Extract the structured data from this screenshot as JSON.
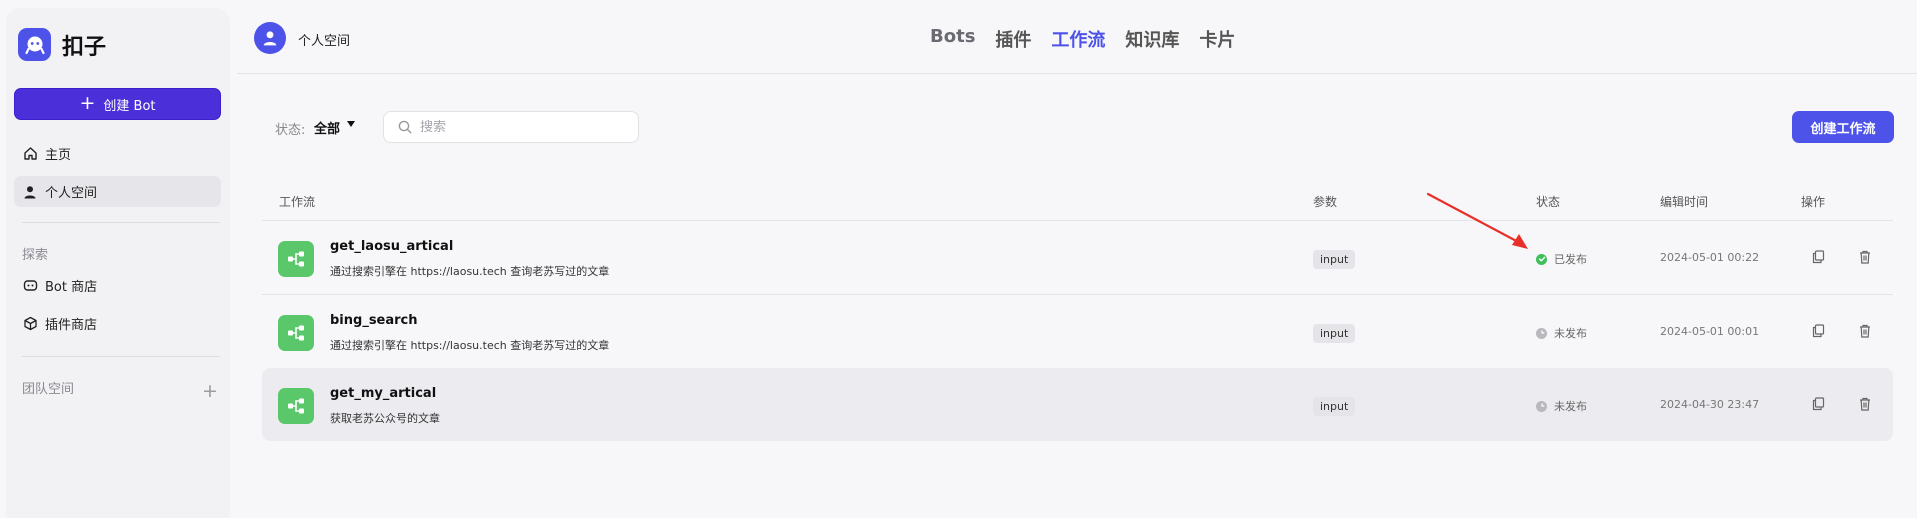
{
  "app": {
    "name": "扣子",
    "brand_color": "#4d53e8"
  },
  "sidebar": {
    "create_bot_label": "创建 Bot",
    "home_label": "主页",
    "personal_space_label": "个人空间",
    "explore_title": "探索",
    "bot_store_label": "Bot 商店",
    "plugin_store_label": "插件商店",
    "team_space_label": "团队空间"
  },
  "header": {
    "space_name": "个人空间",
    "tabs": [
      {
        "label": "Bots"
      },
      {
        "label": "插件"
      },
      {
        "label": "工作流",
        "active": true
      },
      {
        "label": "知识库"
      },
      {
        "label": "卡片"
      }
    ]
  },
  "toolbar": {
    "status_label": "状态:",
    "status_value": "全部",
    "search_placeholder": "搜索",
    "create_workflow_label": "创建工作流"
  },
  "table": {
    "columns": [
      "工作流",
      "参数",
      "状态",
      "编辑时间",
      "操作"
    ],
    "rows": [
      {
        "name": "get_laosu_artical",
        "desc": "通过搜索引擎在 https://laosu.tech 查询老苏写过的文章",
        "param": "input",
        "status": "已发布",
        "published": true,
        "edit_time": "2024-05-01 00:22"
      },
      {
        "name": "bing_search",
        "desc": "通过搜索引擎在 https://laosu.tech 查询老苏写过的文章",
        "param": "input",
        "status": "未发布",
        "published": false,
        "edit_time": "2024-05-01 00:01"
      },
      {
        "name": "get_my_artical",
        "desc": "获取老苏公众号的文章",
        "param": "input",
        "status": "未发布",
        "published": false,
        "edit_time": "2024-04-30 23:47"
      }
    ]
  },
  "colors": {
    "published": "#3fbf5c",
    "unpublished": "#b8b8be",
    "workflow_icon": "#5bc76b",
    "annotation_arrow": "#e8302a"
  },
  "icons": [
    "logo-icon",
    "plus-icon",
    "home-icon",
    "user-icon",
    "bot-icon",
    "cube-icon",
    "search-icon",
    "workflow-icon",
    "check-icon",
    "copy-icon",
    "trash-icon",
    "arrow-annotation"
  ]
}
